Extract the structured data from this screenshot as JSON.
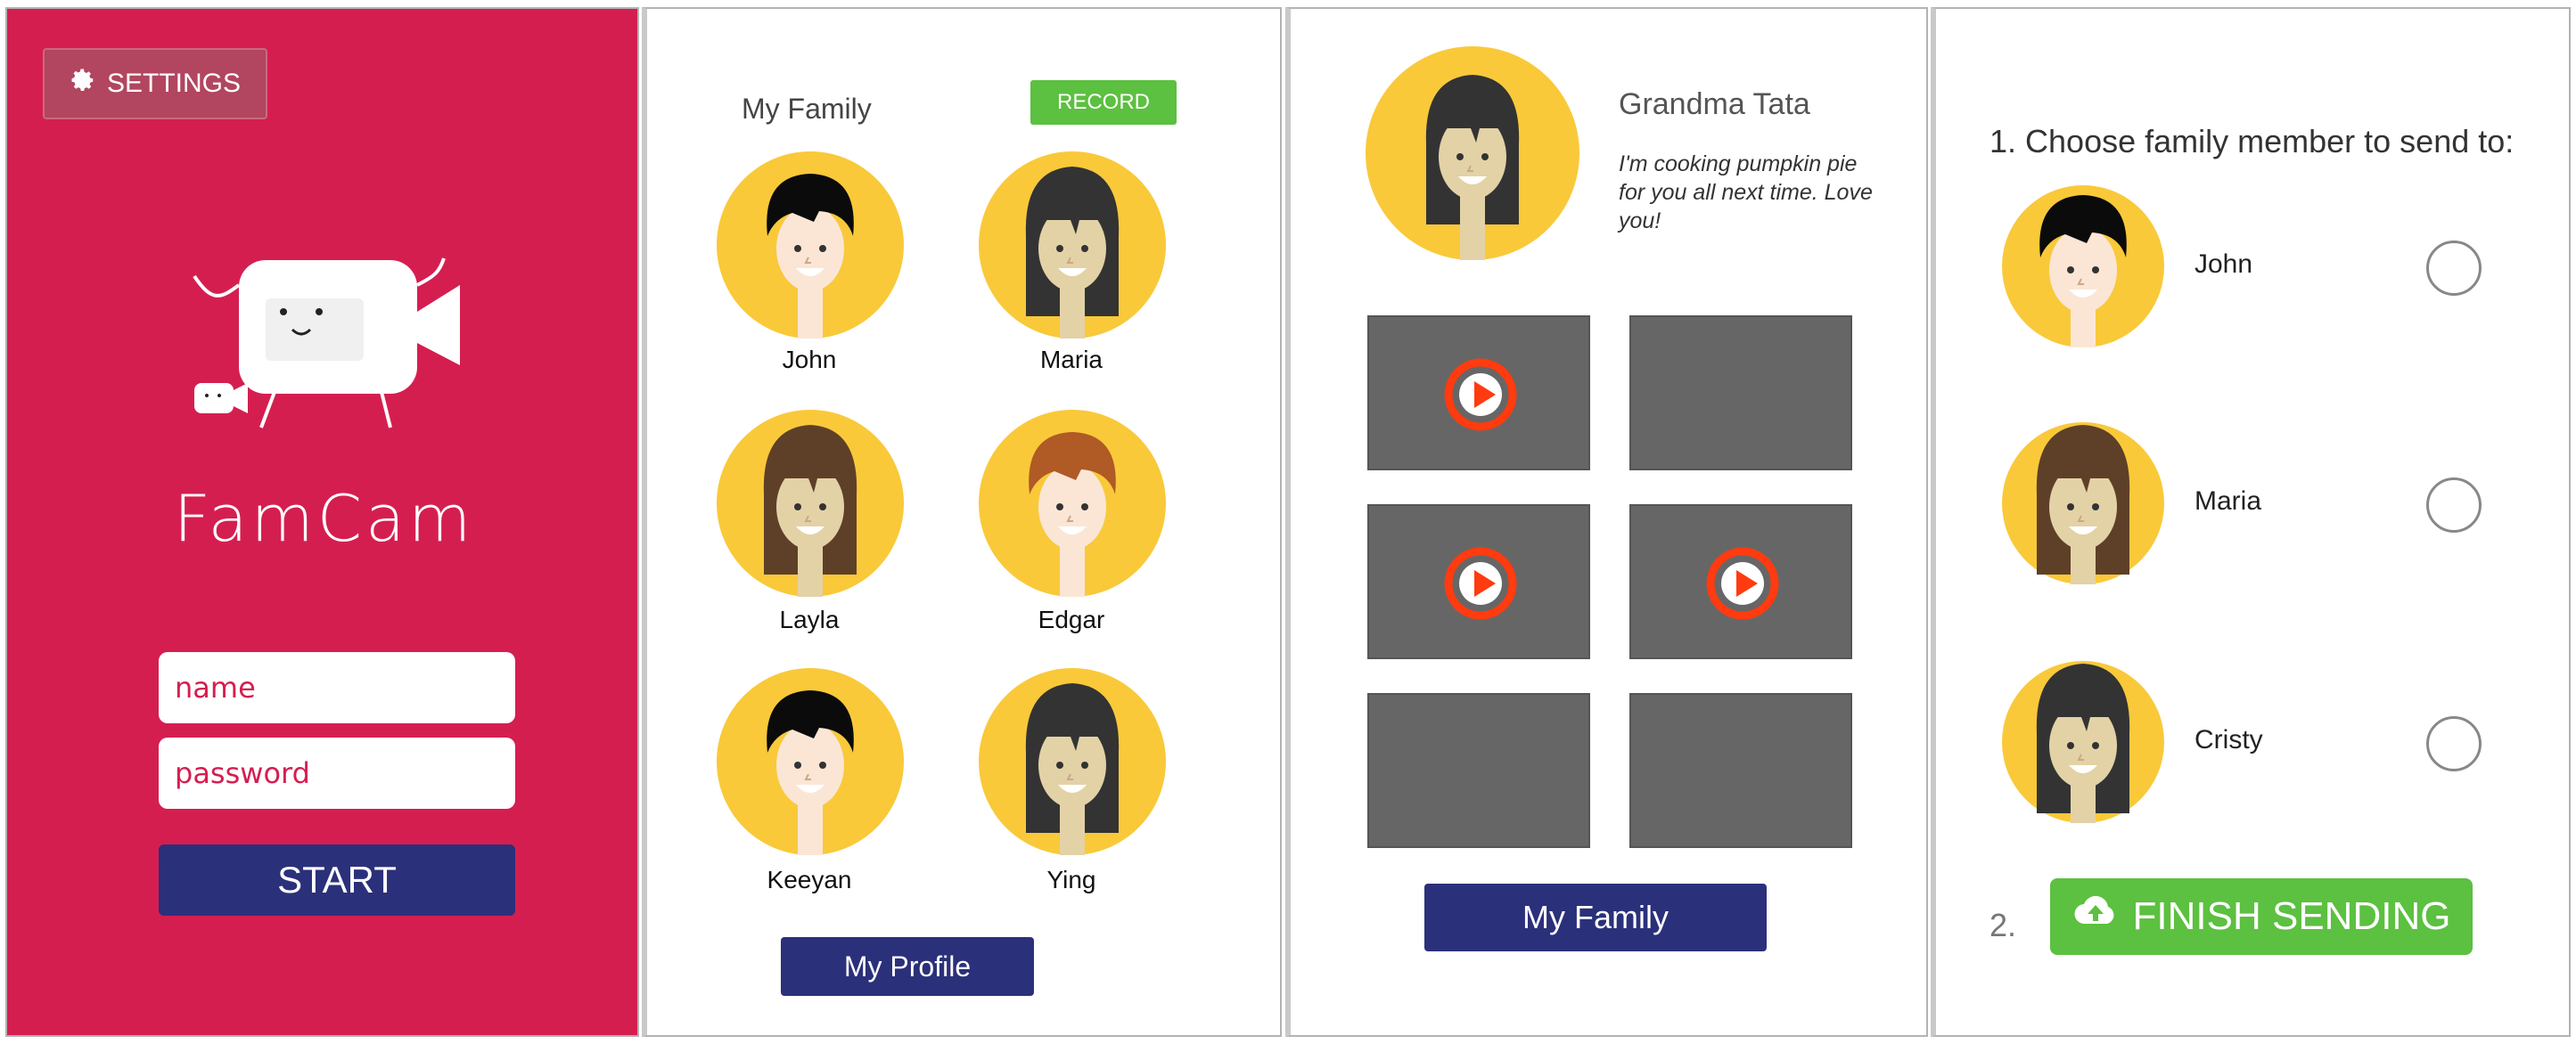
{
  "colors": {
    "brand_red": "#d51e50",
    "navy": "#2b307a",
    "green": "#5cc040",
    "avatar_yellow": "#f9c93a",
    "thumb_gray": "#666666",
    "play_red": "#ff3b0f"
  },
  "login": {
    "settings_label": "SETTINGS",
    "settings_icon": "gear-icon",
    "logo_icon": "camera-mascot-icon",
    "app_name": "FamCam",
    "name_placeholder": "name",
    "password_placeholder": "password",
    "start_label": "START"
  },
  "family": {
    "title": "My Family",
    "record_label": "RECORD",
    "members": [
      {
        "name": "John",
        "hair": "short-black"
      },
      {
        "name": "Maria",
        "hair": "long-dark"
      },
      {
        "name": "Layla",
        "hair": "long-brown"
      },
      {
        "name": "Edgar",
        "hair": "short-auburn"
      },
      {
        "name": "Keeyan",
        "hair": "short-black"
      },
      {
        "name": "Ying",
        "hair": "long-dark"
      }
    ],
    "profile_label": "My Profile"
  },
  "profile": {
    "name": "Grandma Tata",
    "message": "I'm cooking pumpkin pie for you all next time. Love you!",
    "videos": [
      {
        "has_play": true
      },
      {
        "has_play": false
      },
      {
        "has_play": true
      },
      {
        "has_play": true
      },
      {
        "has_play": false
      },
      {
        "has_play": false
      }
    ],
    "play_icon": "play-icon",
    "family_label": "My Family"
  },
  "send": {
    "step1": "1. Choose family member to send to:",
    "recipients": [
      {
        "name": "John",
        "hair": "short-black"
      },
      {
        "name": "Maria",
        "hair": "long-brown"
      },
      {
        "name": "Cristy",
        "hair": "long-dark"
      }
    ],
    "step2": "2.",
    "finish_label": "FINISH SENDING",
    "finish_icon": "cloud-upload-icon"
  }
}
